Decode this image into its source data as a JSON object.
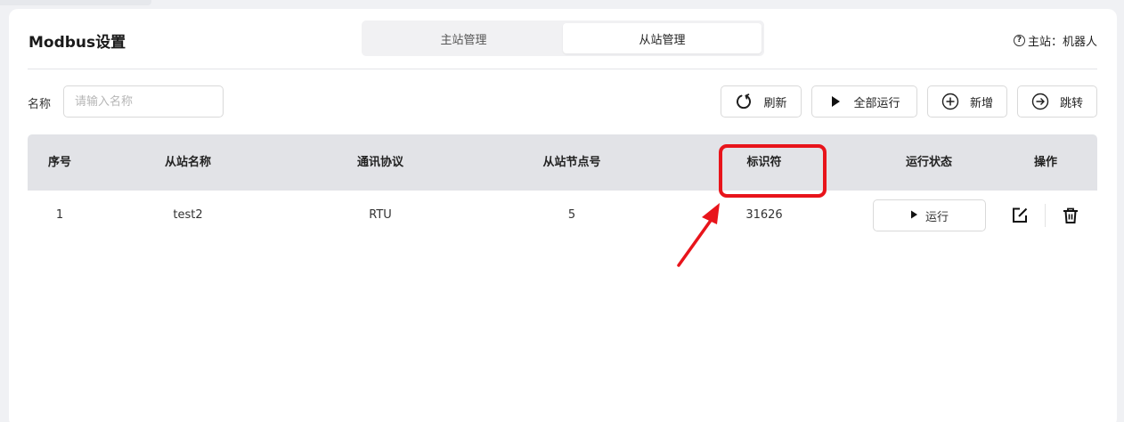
{
  "header": {
    "title": "Modbus设置",
    "tabs": [
      {
        "label": "主站管理",
        "active": false
      },
      {
        "label": "从站管理",
        "active": true
      }
    ],
    "master_label": "主站：机器人"
  },
  "filter": {
    "label": "名称",
    "placeholder": "请输入名称",
    "value": ""
  },
  "toolbar": {
    "refresh_label": "刷新",
    "run_all_label": "全部运行",
    "add_label": "新增",
    "jump_label": "跳转"
  },
  "table": {
    "columns": [
      "序号",
      "从站名称",
      "通讯协议",
      "从站节点号",
      "标识符",
      "运行状态",
      "操作"
    ],
    "rows": [
      {
        "index": "1",
        "name": "test2",
        "protocol": "RTU",
        "node": "5",
        "identifier": "31626",
        "run_label": "运行"
      }
    ]
  },
  "colors": {
    "accent_annotation": "#e8141b",
    "header_bg": "#e2e3e7",
    "page_bg": "#f0f1f4"
  }
}
